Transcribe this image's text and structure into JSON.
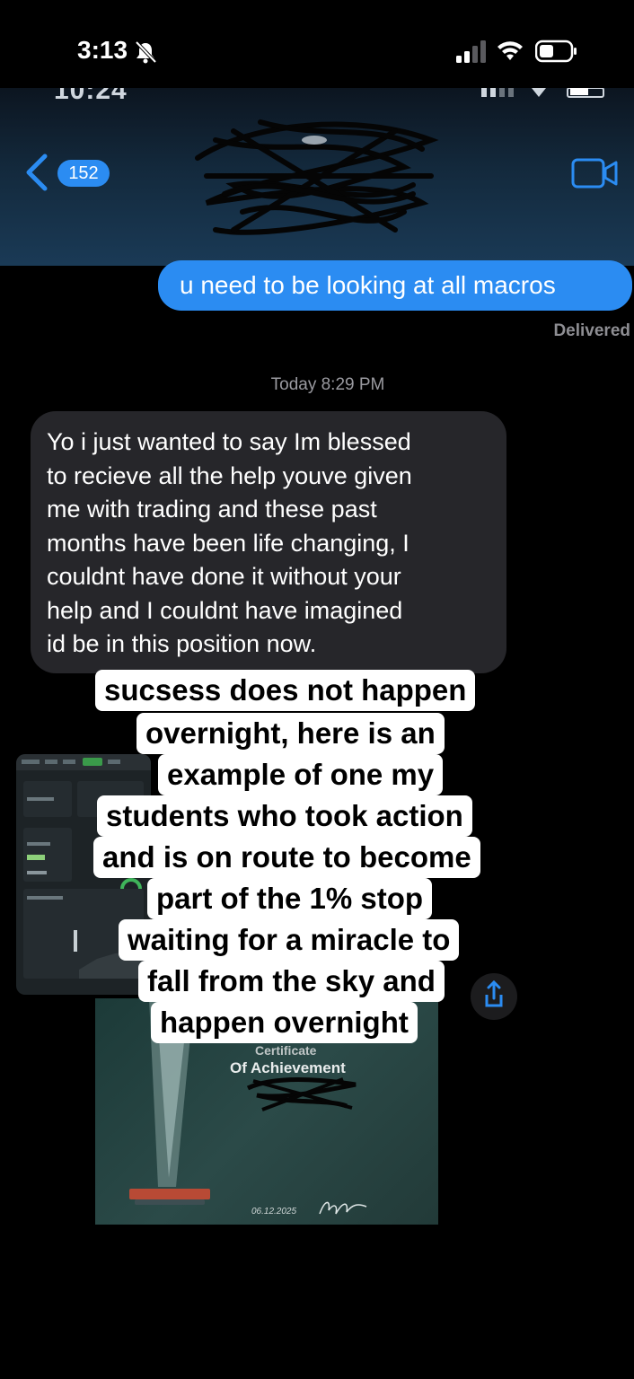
{
  "status_bar": {
    "time": "3:13",
    "bell_icon": "bell-slash-icon",
    "signal_icon": "cellular-signal-icon",
    "wifi_icon": "wifi-icon",
    "battery_icon": "battery-icon"
  },
  "inner_header": {
    "time": "10:24",
    "back_icon": "chevron-left-icon",
    "unread_count": "152",
    "video_icon": "video-camera-icon",
    "accent": "#2b8cf2"
  },
  "conversation": {
    "sent_message": "u need to be looking at all macros",
    "delivered_label": "Delivered",
    "timestamp": "Today 8:29 PM",
    "received_lines": [
      "Yo i just wanted to say Im blessed",
      "to recieve all the help youve given",
      "me with trading and these past",
      "months have been life changing, I",
      "couldnt have done it without your",
      "help and I couldnt have imagined",
      "id be in this position now."
    ]
  },
  "caption": {
    "lines": [
      "sucsess does not happen",
      "overnight, here is an",
      "example of one my",
      "students who took action",
      "and is on route to become",
      "part of the 1% stop",
      "waiting for a miracle to",
      "fall from the sky and",
      "happen overnight"
    ]
  },
  "certificate": {
    "partial_title": "Certificate",
    "title": "Of Achievement",
    "date": "06.12.2025"
  },
  "share_icon": "share-icon"
}
